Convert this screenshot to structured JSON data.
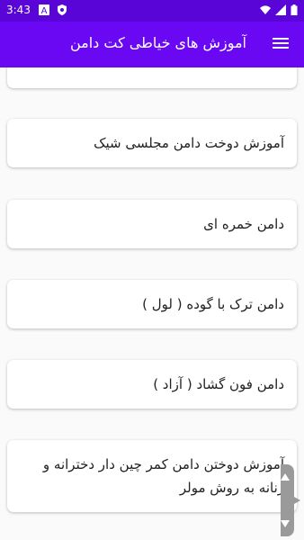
{
  "status": {
    "time": "3:43"
  },
  "appbar": {
    "title": "آموزش های خیاطی کت دامن"
  },
  "list": {
    "items": [
      {
        "label": ""
      },
      {
        "label": "آموزش دوخت دامن مجلسی شیک"
      },
      {
        "label": "دامن خمره ای"
      },
      {
        "label": "دامن ترک با گوده ( لول )"
      },
      {
        "label": "دامن فون گشاد ( آزاد )"
      },
      {
        "label": "آموزش دوختن دامن کمر چین دار دخترانه و زنانه به روش مولر"
      }
    ]
  },
  "colors": {
    "status_bar": "#5a05d8",
    "app_bar": "#6a08f4",
    "background": "#fafafa",
    "card": "#ffffff"
  },
  "icons": {
    "status_left": [
      "a-notification-icon",
      "shield-icon"
    ],
    "status_right": [
      "wifi-icon",
      "signal-icon",
      "battery-icon"
    ],
    "appbar": "menu-icon",
    "scrollbar": "scroll-thumb-icon"
  }
}
